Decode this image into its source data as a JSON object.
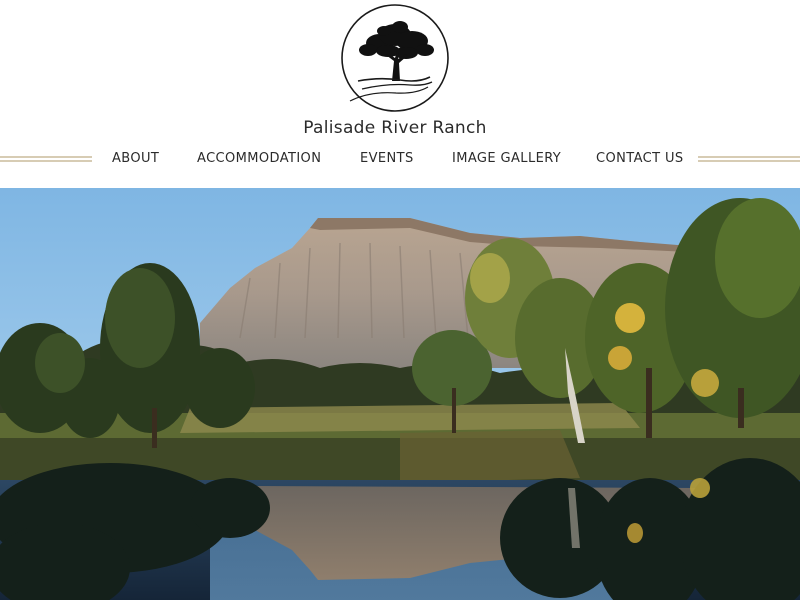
{
  "site": {
    "title": "Palisade River Ranch",
    "logo_icon": "tree-logo-icon"
  },
  "nav": {
    "items": [
      {
        "label": "ABOUT"
      },
      {
        "label": "ACCOMMODATION"
      },
      {
        "label": "EVENTS"
      },
      {
        "label": "IMAGE GALLERY"
      },
      {
        "label": "CONTACT US"
      }
    ]
  },
  "hero": {
    "scene": "mesa-reflection-photo"
  },
  "colors": {
    "rule": "#d7ccb4",
    "text": "#2b2b2b",
    "sky": "#8fc0e6",
    "water": "#1f3650"
  }
}
